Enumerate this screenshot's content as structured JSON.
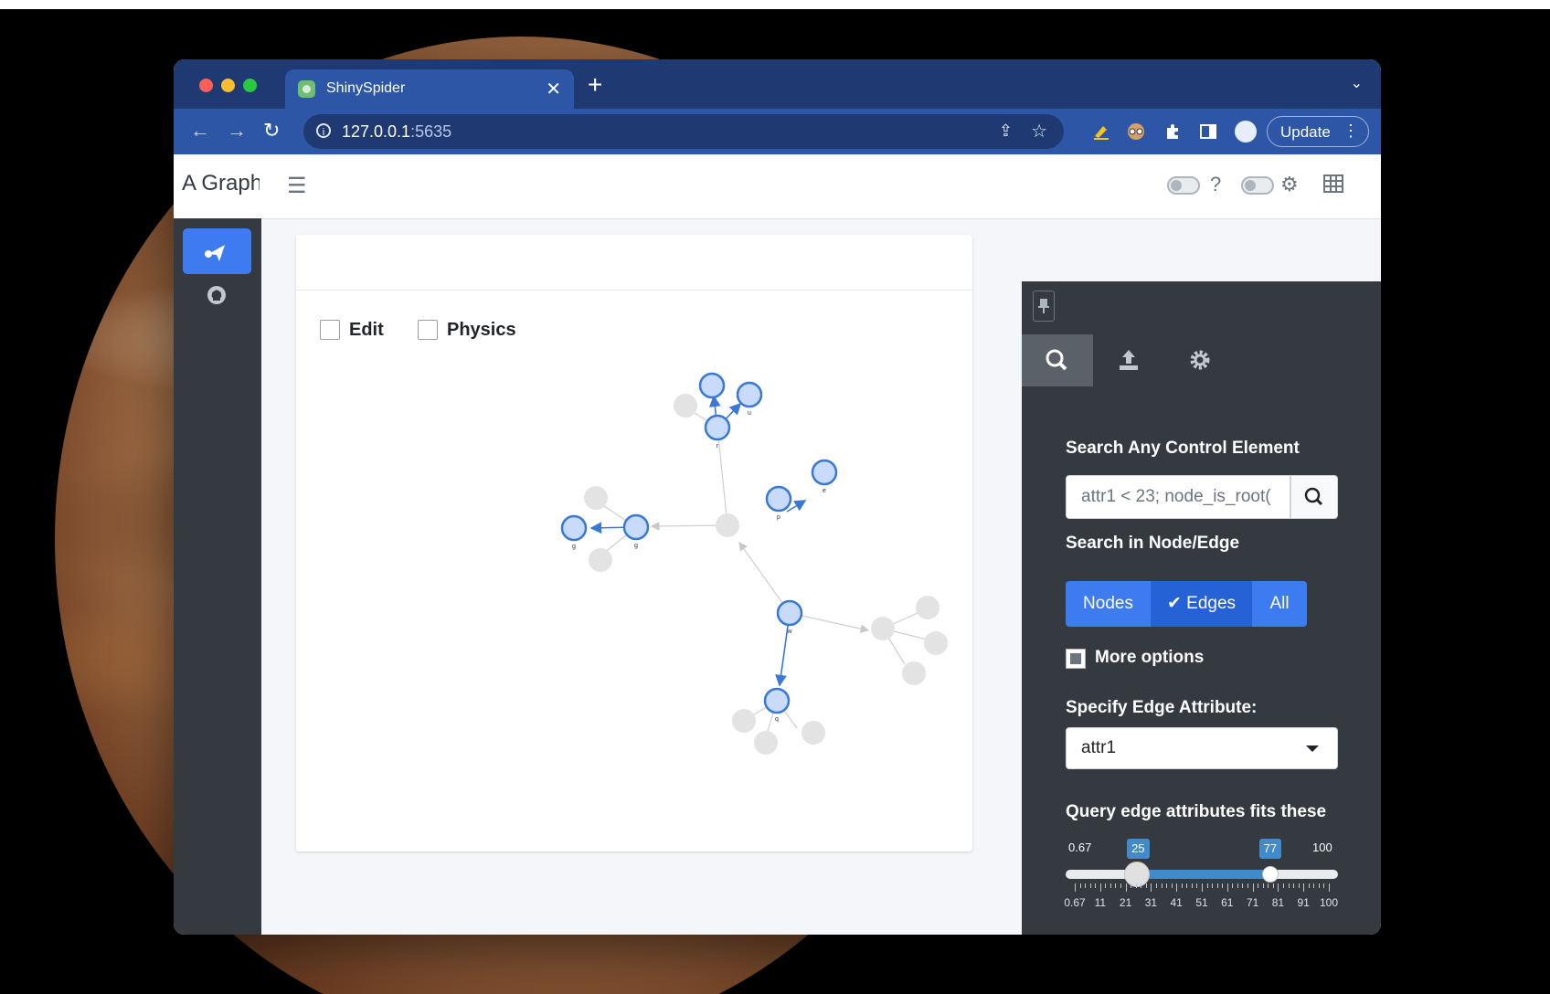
{
  "browser": {
    "tab_title": "ShinySpider",
    "url_host": "127.0.0.1",
    "url_port": ":5635",
    "update_label": "Update"
  },
  "app": {
    "brand": "A Graph"
  },
  "graph_panel": {
    "edit_label": "Edit",
    "physics_label": "Physics",
    "node_labels": {
      "top_center": "r",
      "top_right": "u",
      "mid_right": "p",
      "far_right": "e",
      "left_outer": "g",
      "left_inner": "g",
      "lower_center": "w",
      "bottom": "q"
    }
  },
  "controls": {
    "search_title": "Search Any Control Element",
    "search_placeholder": "attr1 < 23; node_is_root(",
    "search_in_title": "Search in Node/Edge",
    "seg_nodes": "Nodes",
    "seg_edges": "✔ Edges",
    "seg_all": "All",
    "more_options": "More options",
    "edge_attr_title": "Specify Edge Attribute:",
    "edge_attr_value": "attr1",
    "query_title": "Query edge attributes fits these",
    "slider": {
      "min_label": "0.67",
      "max_label": "100",
      "low": 25,
      "high": 77,
      "ticks": [
        "0.67",
        "11",
        "21",
        "31",
        "41",
        "51",
        "61",
        "71",
        "81",
        "91",
        "100"
      ]
    }
  },
  "colors": {
    "accent": "#3c7bf0",
    "node_selected": "#c9dbfa",
    "node_selected_border": "#3a78d8",
    "node_unselected": "#e3e3e3",
    "sidebar": "#343a40"
  }
}
